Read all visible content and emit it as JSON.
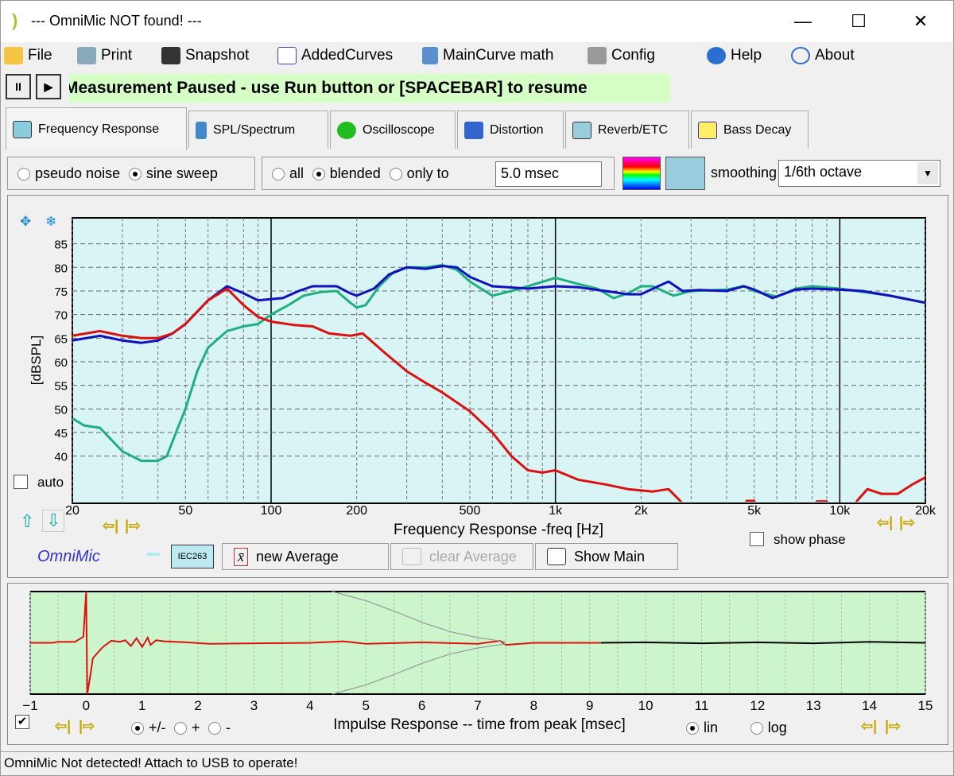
{
  "window": {
    "title": "--- OmniMic NOT found! ---",
    "minimize": "—",
    "maximize": "☐",
    "close": "✕"
  },
  "menu": [
    {
      "label": "File",
      "icon": "folder-icon"
    },
    {
      "label": "Print",
      "icon": "printer-icon"
    },
    {
      "label": "Snapshot",
      "icon": "camera-icon"
    },
    {
      "label": "AddedCurves",
      "icon": "curves-icon"
    },
    {
      "label": "MainCurve math",
      "icon": "calculator-icon"
    },
    {
      "label": "Config",
      "icon": "tools-icon"
    },
    {
      "label": "Help",
      "icon": "help-icon"
    },
    {
      "label": "About",
      "icon": "speech-bubble-icon"
    }
  ],
  "controls": {
    "pause": "II",
    "play": "▶",
    "banner": "Measurement Paused - use Run button or [SPACEBAR] to resume"
  },
  "tabs": [
    {
      "label": "Frequency Response",
      "active": true
    },
    {
      "label": "SPL/Spectrum"
    },
    {
      "label": "Oscilloscope"
    },
    {
      "label": "Distortion"
    },
    {
      "label": "Reverb/ETC"
    },
    {
      "label": "Bass Decay"
    }
  ],
  "options": {
    "signal": [
      {
        "label": "pseudo noise",
        "selected": false
      },
      {
        "label": "sine sweep",
        "selected": true
      }
    ],
    "window": [
      {
        "label": "all",
        "selected": false
      },
      {
        "label": "blended",
        "selected": true
      },
      {
        "label": "only to",
        "selected": false
      }
    ],
    "window_time": "5.0 msec",
    "smoothing_label": "smoothing",
    "smoothing_value": "1/6th octave"
  },
  "freq_panel": {
    "auto_label": "auto",
    "auto_checked": false,
    "show_phase_label": "show phase",
    "show_phase_checked": false,
    "brand": "OmniMic",
    "mic_label": "IEC263",
    "new_average": "new Average",
    "clear_average": "clear Average",
    "show_main": "Show Main",
    "nav_left": "⇦|",
    "nav_right": "|⇨"
  },
  "chart_data": [
    {
      "type": "line",
      "title": "",
      "xlabel": "Frequency Response -freq [Hz]",
      "ylabel": "[dBSPL]",
      "xscale": "log",
      "xlim": [
        20,
        20000
      ],
      "ylim": [
        30,
        90.5
      ],
      "grid": true,
      "xticks": [
        {
          "v": 20,
          "l": "20"
        },
        {
          "v": 50,
          "l": "50"
        },
        {
          "v": 100,
          "l": "100"
        },
        {
          "v": 200,
          "l": "200"
        },
        {
          "v": 500,
          "l": "500"
        },
        {
          "v": 1000,
          "l": "1k"
        },
        {
          "v": 2000,
          "l": "2k"
        },
        {
          "v": 5000,
          "l": "5k"
        },
        {
          "v": 10000,
          "l": "10k"
        },
        {
          "v": 20000,
          "l": "20k"
        }
      ],
      "yticks": [
        85,
        80,
        75,
        70,
        65,
        60,
        55,
        50,
        45,
        40
      ],
      "background": "#d8f4f4",
      "series": [
        {
          "color": "#20b080",
          "points": [
            [
              20,
              48
            ],
            [
              22,
              46.5
            ],
            [
              25,
              46
            ],
            [
              30,
              41
            ],
            [
              35,
              39
            ],
            [
              40,
              39
            ],
            [
              43,
              40
            ],
            [
              47,
              46
            ],
            [
              50,
              50
            ],
            [
              55,
              58
            ],
            [
              60,
              63
            ],
            [
              70,
              66.5
            ],
            [
              80,
              67.5
            ],
            [
              90,
              68
            ],
            [
              100,
              70
            ],
            [
              115,
              72
            ],
            [
              130,
              74
            ],
            [
              150,
              74.8
            ],
            [
              170,
              75
            ],
            [
              190,
              72.5
            ],
            [
              200,
              71.5
            ],
            [
              215,
              72
            ],
            [
              240,
              76
            ],
            [
              270,
              79
            ],
            [
              300,
              80
            ],
            [
              350,
              80
            ],
            [
              400,
              80.5
            ],
            [
              450,
              79.5
            ],
            [
              500,
              77
            ],
            [
              600,
              74
            ],
            [
              700,
              75
            ],
            [
              800,
              76
            ],
            [
              1000,
              77.8
            ],
            [
              1200,
              76.5
            ],
            [
              1400,
              75.5
            ],
            [
              1600,
              73.5
            ],
            [
              1800,
              74.5
            ],
            [
              2000,
              76
            ],
            [
              2200,
              76
            ],
            [
              2600,
              74
            ],
            [
              3000,
              75
            ],
            [
              4000,
              75.3
            ],
            [
              4600,
              76
            ],
            [
              5000,
              75
            ],
            [
              6000,
              73.8
            ],
            [
              7000,
              75.5
            ],
            [
              8000,
              76
            ],
            [
              10000,
              75.5
            ],
            [
              15000,
              74
            ],
            [
              20000,
              72.5
            ]
          ]
        },
        {
          "color": "#1010c0",
          "points": [
            [
              20,
              64.5
            ],
            [
              25,
              65.5
            ],
            [
              30,
              64.5
            ],
            [
              35,
              64
            ],
            [
              40,
              64.5
            ],
            [
              45,
              66
            ],
            [
              50,
              68
            ],
            [
              60,
              73
            ],
            [
              70,
              76
            ],
            [
              80,
              74.5
            ],
            [
              90,
              73
            ],
            [
              110,
              73.5
            ],
            [
              125,
              75
            ],
            [
              140,
              76
            ],
            [
              170,
              76
            ],
            [
              190,
              74.5
            ],
            [
              200,
              74
            ],
            [
              230,
              75.5
            ],
            [
              260,
              78.5
            ],
            [
              300,
              80
            ],
            [
              350,
              79.7
            ],
            [
              400,
              80.3
            ],
            [
              450,
              80
            ],
            [
              500,
              78
            ],
            [
              600,
              76
            ],
            [
              800,
              75.5
            ],
            [
              1000,
              76
            ],
            [
              1200,
              75.8
            ],
            [
              1500,
              75
            ],
            [
              1800,
              74.3
            ],
            [
              2000,
              74.3
            ],
            [
              2300,
              76
            ],
            [
              2500,
              77
            ],
            [
              2800,
              75
            ],
            [
              3200,
              75.2
            ],
            [
              4000,
              75
            ],
            [
              4600,
              76
            ],
            [
              5000,
              75.3
            ],
            [
              5800,
              73.5
            ],
            [
              7000,
              75.3
            ],
            [
              8000,
              75.5
            ],
            [
              10000,
              75.3
            ],
            [
              12000,
              75
            ],
            [
              15000,
              74
            ],
            [
              20000,
              72.5
            ]
          ]
        },
        {
          "color": "#dd1010",
          "points": [
            [
              20,
              65.5
            ],
            [
              25,
              66.5
            ],
            [
              30,
              65.5
            ],
            [
              35,
              65
            ],
            [
              40,
              65
            ],
            [
              45,
              66
            ],
            [
              50,
              68
            ],
            [
              60,
              73
            ],
            [
              70,
              75.5
            ],
            [
              80,
              72
            ],
            [
              90,
              69.5
            ],
            [
              100,
              68.5
            ],
            [
              120,
              67.8
            ],
            [
              140,
              67.5
            ],
            [
              160,
              66
            ],
            [
              190,
              65.5
            ],
            [
              210,
              66
            ],
            [
              250,
              62
            ],
            [
              300,
              58
            ],
            [
              350,
              55.5
            ],
            [
              400,
              53.5
            ],
            [
              500,
              49.5
            ],
            [
              600,
              45
            ],
            [
              700,
              40
            ],
            [
              800,
              37
            ],
            [
              900,
              36.5
            ],
            [
              1000,
              37
            ],
            [
              1200,
              35
            ],
            [
              1500,
              34
            ],
            [
              1800,
              33
            ],
            [
              2200,
              32.5
            ],
            [
              2500,
              33
            ],
            [
              2800,
              30
            ],
            [
              3300,
              26
            ],
            [
              4500,
              26
            ],
            [
              4700,
              30.5
            ],
            [
              5000,
              30.5
            ],
            [
              5300,
              27
            ],
            [
              8000,
              27
            ],
            [
              8300,
              30.4
            ],
            [
              9000,
              30.4
            ],
            [
              9300,
              27
            ],
            [
              10800,
              27
            ],
            [
              11500,
              30.5
            ],
            [
              12500,
              33
            ],
            [
              14000,
              32
            ],
            [
              16000,
              32
            ],
            [
              18000,
              34
            ],
            [
              20000,
              35.5
            ]
          ]
        }
      ]
    },
    {
      "type": "line",
      "title": "",
      "xlabel": "Impulse Response  -- time from peak [msec]",
      "xlim": [
        -1,
        15
      ],
      "ylim": [
        -1,
        1
      ],
      "grid": true,
      "background": "#ccf5cc",
      "xticks": [
        -1,
        0,
        1,
        2,
        3,
        4,
        5,
        6,
        7,
        8,
        9,
        10,
        11,
        12,
        13,
        14,
        15
      ],
      "series": [
        {
          "color": "#dd1010",
          "points": [
            [
              -1,
              0
            ],
            [
              -0.6,
              0
            ],
            [
              -0.5,
              0.02
            ],
            [
              -0.2,
              0.02
            ],
            [
              -0.05,
              0.12
            ],
            [
              0,
              1
            ],
            [
              0.02,
              -1
            ],
            [
              0.08,
              -0.6
            ],
            [
              0.12,
              -0.3
            ],
            [
              0.2,
              -0.2
            ],
            [
              0.3,
              -0.08
            ],
            [
              0.45,
              0.04
            ],
            [
              0.6,
              0.02
            ],
            [
              0.7,
              0.05
            ],
            [
              0.8,
              -0.06
            ],
            [
              0.9,
              0.09
            ],
            [
              1.0,
              -0.08
            ],
            [
              1.1,
              0.1
            ],
            [
              1.15,
              -0.04
            ],
            [
              1.25,
              0.05
            ],
            [
              1.4,
              0.03
            ],
            [
              1.8,
              0.01
            ],
            [
              2.2,
              -0.02
            ],
            [
              3,
              -0.01
            ],
            [
              4,
              0
            ],
            [
              4.6,
              0.03
            ],
            [
              5,
              -0.02
            ],
            [
              6,
              0.01
            ],
            [
              7,
              -0.02
            ],
            [
              7.4,
              0.04
            ],
            [
              7.5,
              -0.04
            ],
            [
              8,
              0
            ],
            [
              9.2,
              0
            ]
          ]
        },
        {
          "color": "#000000",
          "points": [
            [
              9.2,
              0
            ],
            [
              10,
              0.01
            ],
            [
              11,
              -0.01
            ],
            [
              12,
              0.01
            ],
            [
              13,
              -0.01
            ],
            [
              14,
              0.02
            ],
            [
              15,
              0
            ]
          ]
        },
        {
          "color": "#999999",
          "points": [
            [
              4.4,
              1
            ],
            [
              5,
              0.82
            ],
            [
              5.5,
              0.62
            ],
            [
              6,
              0.4
            ],
            [
              6.5,
              0.22
            ],
            [
              7,
              0.1
            ],
            [
              7.5,
              0.02
            ]
          ]
        },
        {
          "color": "#999999",
          "points": [
            [
              4.4,
              -1
            ],
            [
              5,
              -0.82
            ],
            [
              5.5,
              -0.62
            ],
            [
              6,
              -0.4
            ],
            [
              6.5,
              -0.22
            ],
            [
              7,
              -0.1
            ],
            [
              7.5,
              -0.02
            ]
          ]
        }
      ]
    }
  ],
  "impulse_panel": {
    "checked": true,
    "polarity": [
      {
        "label": "+/-",
        "selected": true
      },
      {
        "label": "+",
        "selected": false
      },
      {
        "label": "-",
        "selected": false
      }
    ],
    "scale": [
      {
        "label": "lin",
        "selected": true
      },
      {
        "label": "log",
        "selected": false
      }
    ],
    "nav_left": "⇦|",
    "nav_right": "|⇨"
  },
  "status": "OmniMic Not detected! Attach to USB to operate!"
}
